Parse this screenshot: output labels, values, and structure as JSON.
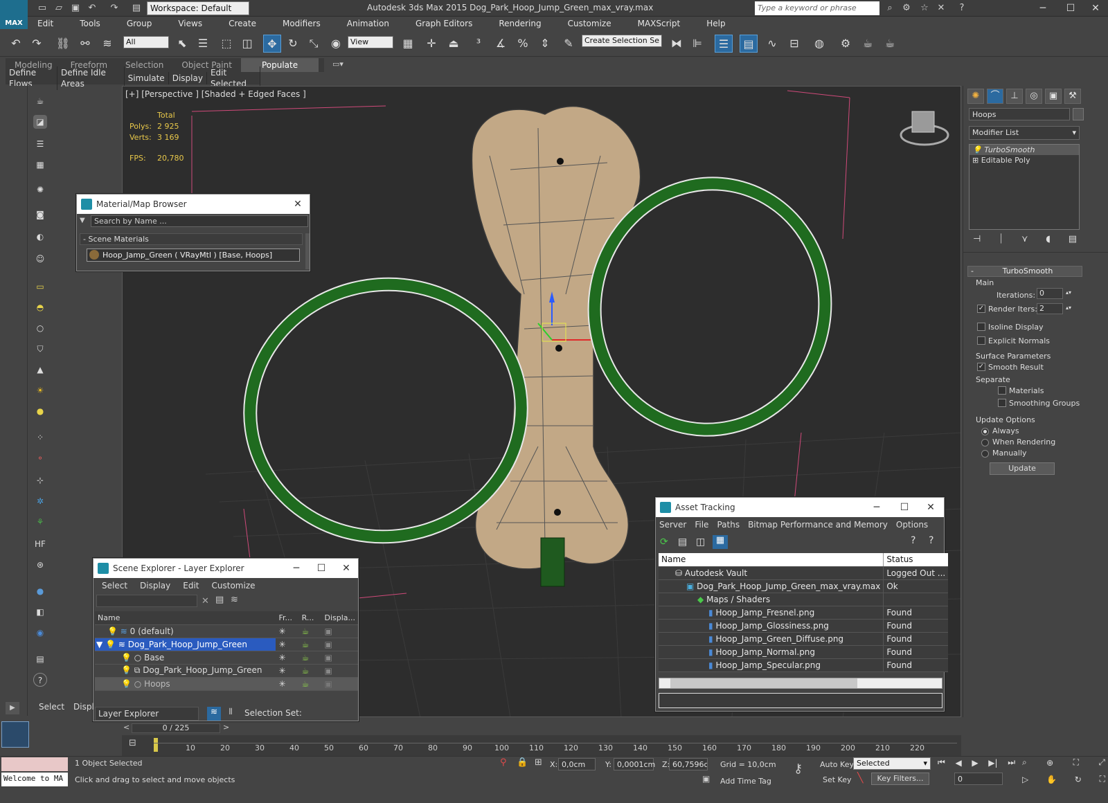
{
  "title_bar": {
    "workspace": "Workspace: Default",
    "app_title": "Autodesk 3ds Max  2015    Dog_Park_Hoop_Jump_Green_max_vray.max",
    "search_placeholder": "Type a keyword or phrase",
    "logo_text": "MAX"
  },
  "menu": [
    "Edit",
    "Tools",
    "Group",
    "Views",
    "Create",
    "Modifiers",
    "Animation",
    "Graph Editors",
    "Rendering",
    "Customize",
    "MAXScript",
    "Help"
  ],
  "toolbar": {
    "selection_filter": "All",
    "ref_coord": "View",
    "named_selection": "Create Selection Se"
  },
  "ribbon": {
    "tabs": [
      "Modeling",
      "Freeform",
      "Selection",
      "Object Paint",
      "Populate"
    ],
    "active_tab": "Populate",
    "subtabs": [
      "Define Flows",
      "Define Idle Areas",
      "Simulate",
      "Display",
      "Edit Selected"
    ]
  },
  "viewport": {
    "label": "[+] [Perspective ] [Shaded + Edged Faces ]",
    "stats": {
      "total_label": "Total",
      "polys_label": "Polys:",
      "polys": "2 925",
      "verts_label": "Verts:",
      "verts": "3 169",
      "fps_label": "FPS:",
      "fps": "20,780"
    }
  },
  "command_panel": {
    "object_name": "Hoops",
    "modifier_list": "Modifier List",
    "stack": [
      "TurboSmooth",
      "Editable Poly"
    ],
    "rollout_title": "TurboSmooth",
    "main_label": "Main",
    "iterations_label": "Iterations:",
    "iterations": "0",
    "render_iters_label": "Render Iters:",
    "render_iters": "2",
    "isoline_label": "Isoline Display",
    "explicit_normals_label": "Explicit Normals",
    "surface_params_label": "Surface Parameters",
    "smooth_result_label": "Smooth Result",
    "separate_label": "Separate",
    "materials_label": "Materials",
    "smoothing_groups_label": "Smoothing Groups",
    "update_options_label": "Update Options",
    "always_label": "Always",
    "when_rendering_label": "When Rendering",
    "manually_label": "Manually",
    "update_button": "Update"
  },
  "material_browser": {
    "title": "Material/Map Browser",
    "search_placeholder": "Search by Name ...",
    "group": "- Scene Materials",
    "item": "Hoop_Jamp_Green ( VRayMtl ) [Base, Hoops]"
  },
  "scene_explorer": {
    "title": "Scene Explorer - Layer Explorer",
    "menus": [
      "Select",
      "Display",
      "Edit",
      "Customize"
    ],
    "columns": [
      "Name",
      "Fr...",
      "R...",
      "Displa..."
    ],
    "rows": [
      {
        "name": "0 (default)",
        "selected": false
      },
      {
        "name": "Dog_Park_Hoop_Jump_Green",
        "selected": true
      },
      {
        "name": "Base",
        "selected": false
      },
      {
        "name": "Dog_Park_Hoop_Jump_Green",
        "selected": false
      },
      {
        "name": "Hoops",
        "selected": false
      }
    ],
    "explorer_select": "Layer Explorer",
    "selection_set_label": "Selection Set:"
  },
  "asset_tracking": {
    "title": "Asset Tracking",
    "menus": [
      "Server",
      "File",
      "Paths",
      "Bitmap Performance and Memory",
      "Options"
    ],
    "columns": [
      "Name",
      "Status"
    ],
    "rows": [
      {
        "name": "Autodesk Vault",
        "status": "Logged Out ..."
      },
      {
        "name": "Dog_Park_Hoop_Jump_Green_max_vray.max",
        "status": "Ok"
      },
      {
        "name": "Maps / Shaders",
        "status": ""
      },
      {
        "name": "Hoop_Jamp_Fresnel.png",
        "status": "Found"
      },
      {
        "name": "Hoop_Jamp_Glossiness.png",
        "status": "Found"
      },
      {
        "name": "Hoop_Jamp_Green_Diffuse.png",
        "status": "Found"
      },
      {
        "name": "Hoop_Jamp_Normal.png",
        "status": "Found"
      },
      {
        "name": "Hoop_Jamp_Specular.png",
        "status": "Found"
      }
    ]
  },
  "timeline": {
    "frame": "0 / 225",
    "ticks": [
      "10",
      "20",
      "30",
      "40",
      "50",
      "60",
      "70",
      "80",
      "90",
      "100",
      "110",
      "120",
      "130",
      "140",
      "150",
      "160",
      "170",
      "180",
      "190",
      "200",
      "210",
      "220"
    ],
    "left_tabs": [
      "Select",
      "Displ"
    ]
  },
  "status": {
    "objects_selected": "1 Object Selected",
    "prompt": "Click and drag to select and move objects",
    "maxscript": "Welcome to MA",
    "x_label": "X:",
    "x": "0,0cm",
    "y_label": "Y:",
    "y": "0,0001cm",
    "z_label": "Z:",
    "z": "60,7596cm",
    "grid": "Grid = 10,0cm",
    "add_time_tag": "Add Time Tag",
    "auto_key": "Auto Key",
    "set_key": "Set Key",
    "key_mode": "Selected",
    "key_filters": "Key Filters...",
    "current_frame": "0"
  },
  "colors": {
    "selection_blue": "#2a5bbf",
    "hoop_green": "#1f6b1f",
    "bone_tan": "#c2a886",
    "accent": "#1e8ea6"
  }
}
